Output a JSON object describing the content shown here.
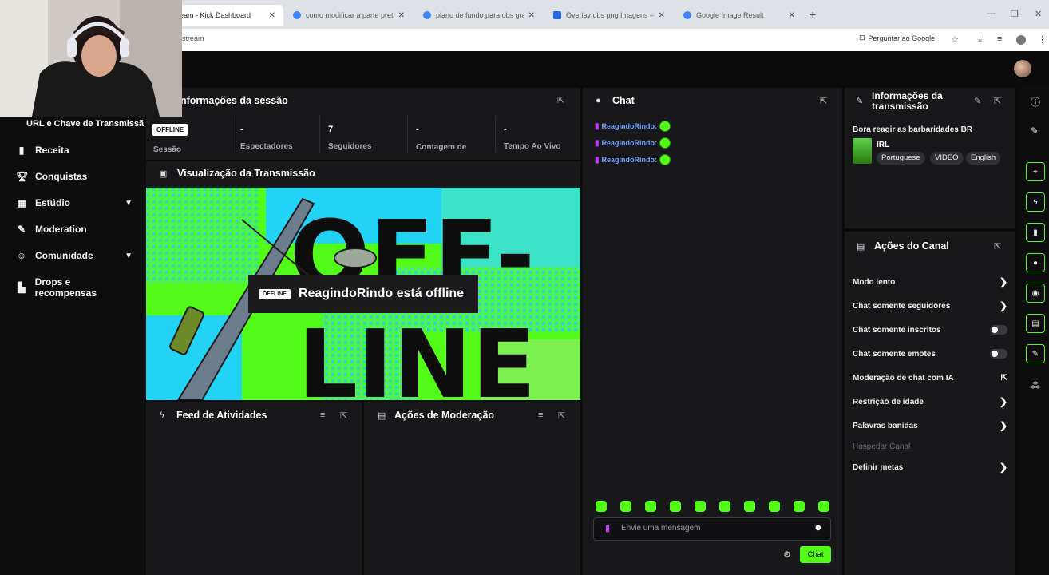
{
  "browser": {
    "tabs": [
      {
        "label": "eam - Kick Dashboard",
        "favicon_color": "#53fc18"
      },
      {
        "label": "como modificar a parte preta d",
        "favicon_color": "#4285f4"
      },
      {
        "label": "plano de fundo para obs gratis",
        "favicon_color": "#4285f4"
      },
      {
        "label": "Overlay obs png Imagens – Do",
        "favicon_color": "#2563eb"
      },
      {
        "label": "Google Image Result",
        "favicon_color": "#4285f4"
      }
    ],
    "tab_close": "✕",
    "new_tab": "+",
    "url": "stream",
    "ask_google": "Perguntar ao Google"
  },
  "sidebar": {
    "url_key_label": "URL e Chave de Transmissã",
    "items": [
      {
        "label": "Receita",
        "icon": "chart-icon"
      },
      {
        "label": "Conquistas",
        "icon": "trophy-icon"
      },
      {
        "label": "Estúdio",
        "icon": "studio-icon",
        "expandable": true
      },
      {
        "label": "Moderation",
        "icon": "wrench-icon"
      },
      {
        "label": "Comunidade",
        "icon": "users-icon",
        "expandable": true
      },
      {
        "label": "Drops e recompensas",
        "icon": "gift-icon"
      }
    ]
  },
  "session": {
    "title": "nformações da sessão",
    "status_badge": "OFFLINE",
    "stats": [
      {
        "label": "Sessão",
        "value": ""
      },
      {
        "label": "Espectadores",
        "value": "-"
      },
      {
        "label": "Seguidores",
        "value": "7"
      },
      {
        "label": "Contagem de inscritos",
        "value": "-"
      },
      {
        "label": "Tempo Ao Vivo",
        "value": "-"
      }
    ]
  },
  "preview": {
    "title": "Visualização da Transmissão",
    "offline_badge": "OFFLINE",
    "offline_message": "ReagindoRindo está offline",
    "art_text_top": "OFF-",
    "art_text_bottom": "LINE"
  },
  "activity_feed": {
    "title": "Feed de Atividades"
  },
  "mod_actions": {
    "title": "Ações de Moderação"
  },
  "chat": {
    "title": "Chat",
    "messages": [
      {
        "user": "ReagindoRindo:"
      },
      {
        "user": "ReagindoRindo:"
      },
      {
        "user": "ReagindoRindo:"
      }
    ],
    "input_placeholder": "Envie uma mensagem",
    "send_label": "Chat"
  },
  "stream_info": {
    "title": "Informações da transmissão",
    "stream_title": "Bora reagir as barbaridades BR",
    "category": "IRL",
    "tags": [
      "Portuguese",
      "VIDEO",
      "English"
    ]
  },
  "channel_actions": {
    "title": "Ações do Canal",
    "items": [
      {
        "label": "Modo lento",
        "control": "chevron"
      },
      {
        "label": "Chat somente seguidores",
        "control": "chevron"
      },
      {
        "label": "Chat somente inscritos",
        "control": "toggle",
        "on": false
      },
      {
        "label": "Chat somente emotes",
        "control": "toggle",
        "on": false
      },
      {
        "label": "Moderação de chat com IA",
        "control": "external"
      },
      {
        "label": "Restrição de idade",
        "control": "chevron"
      },
      {
        "label": "Palavras banidas",
        "control": "chevron"
      },
      {
        "label": "Hospedar Canal",
        "control": "none",
        "disabled": true
      },
      {
        "label": "Definir metas",
        "control": "chevron"
      }
    ]
  },
  "colors": {
    "accent": "#53fc18",
    "panel": "#18181b",
    "bg": "#0b0b0c",
    "username": "#6fa3ff"
  }
}
